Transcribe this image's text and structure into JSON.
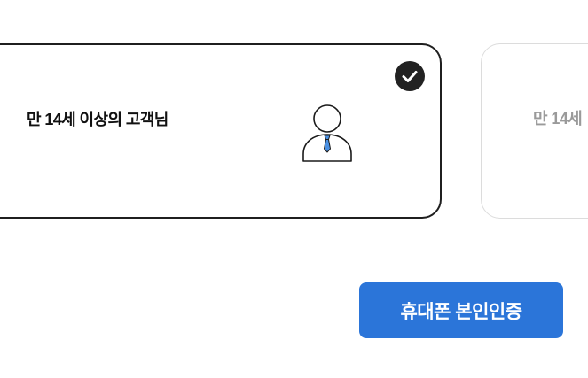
{
  "customer_types": [
    {
      "label": "만 14세 이상의 고객님",
      "selected": true,
      "icon": "person-with-tie-icon"
    },
    {
      "label": "만 14세",
      "selected": false
    }
  ],
  "actions": {
    "verify_button_label": "휴대폰 본인인증"
  },
  "colors": {
    "accent": "#2b75d9",
    "selected_border": "#1f1f1f",
    "unselected_border": "#dcdcdc",
    "check_badge": "#222222",
    "tie": "#4a90e2"
  }
}
